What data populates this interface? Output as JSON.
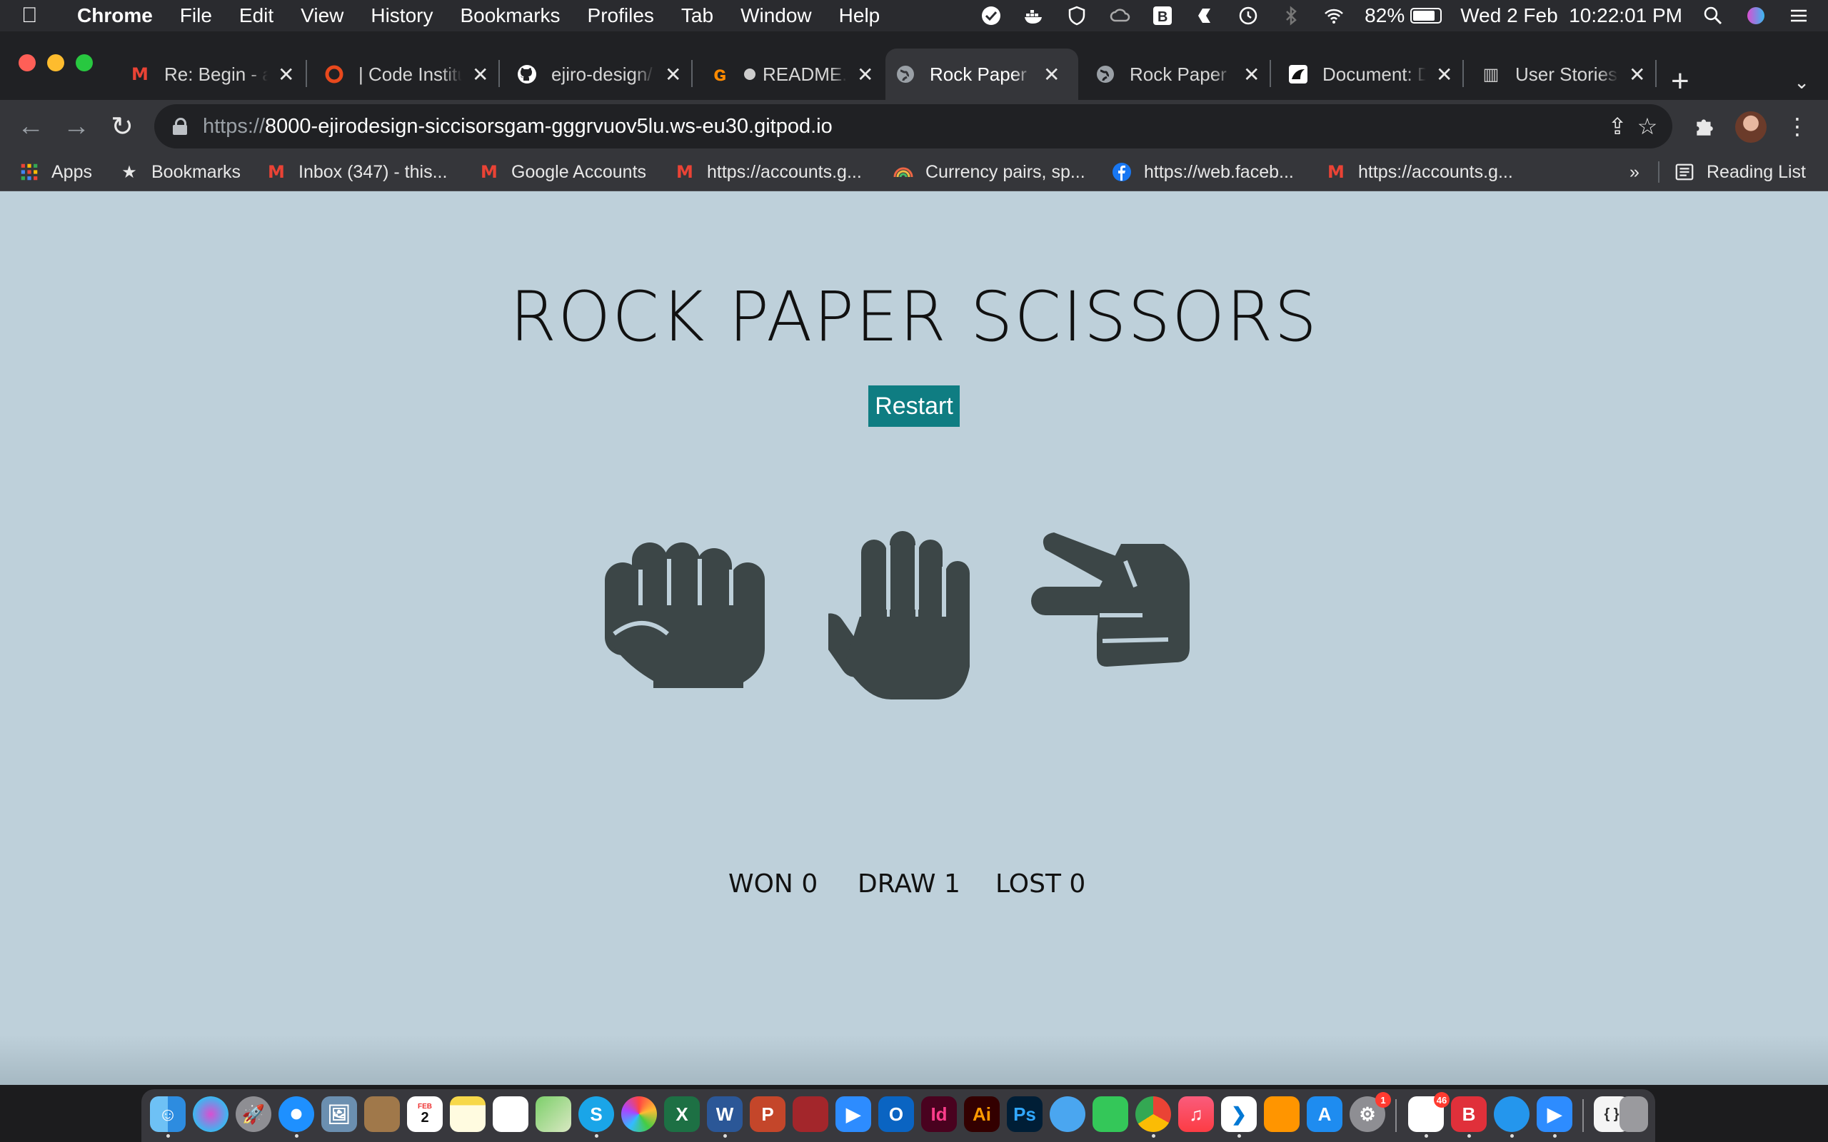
{
  "menubar": {
    "app": "Chrome",
    "menus": [
      "File",
      "Edit",
      "View",
      "History",
      "Bookmarks",
      "Profiles",
      "Tab",
      "Window",
      "Help"
    ],
    "battery_percent": "82%",
    "battery_level": 0.82,
    "datetime": "Wed 2 Feb  10:22:01 PM"
  },
  "tabs": [
    {
      "title": "Re: Begin - a",
      "icon": "gmail-icon",
      "active": false
    },
    {
      "title": "| Code Institu",
      "icon": "code-institute-icon",
      "active": false
    },
    {
      "title": "ejiro-design/",
      "icon": "github-icon",
      "active": false
    },
    {
      "title": "README.m",
      "icon": "gitpod-icon",
      "active": false
    },
    {
      "title": "Rock Paper S",
      "icon": "globe-icon",
      "active": true
    },
    {
      "title": "Rock Paper S",
      "icon": "globe-icon",
      "active": false
    },
    {
      "title": "Document: D",
      "icon": "mdn-icon",
      "active": false
    },
    {
      "title": "User Stories",
      "icon": "book-icon",
      "active": false
    }
  ],
  "toolbar": {
    "url_scheme": "https://",
    "url_host": "8000-ejirodesign-siccisorsgam-gggrvuov5lu.ws-eu30.gitpod.io"
  },
  "bookmarks": {
    "items": [
      {
        "label": "Apps",
        "icon": "apps-grid-icon"
      },
      {
        "label": "Bookmarks",
        "icon": "star-icon"
      },
      {
        "label": "Inbox (347) - this...",
        "icon": "gmail-icon"
      },
      {
        "label": "Google Accounts",
        "icon": "gmail-icon"
      },
      {
        "label": "https://accounts.g...",
        "icon": "gmail-icon"
      },
      {
        "label": "Currency pairs, sp...",
        "icon": "rainbow-icon"
      },
      {
        "label": "https://web.faceb...",
        "icon": "facebook-icon"
      },
      {
        "label": "https://accounts.g...",
        "icon": "gmail-icon"
      }
    ],
    "overflow": "»",
    "reading_list": "Reading List"
  },
  "game": {
    "title": "ROCK PAPER SCISSORS",
    "restart_label": "Restart",
    "choices": [
      "rock",
      "paper",
      "scissors"
    ],
    "score": {
      "won_label": "WON",
      "won": 0,
      "draw_label": "DRAW",
      "draw": 1,
      "lost_label": "LOST",
      "lost": 0
    }
  },
  "dock": {
    "apps": [
      "Finder",
      "Siri",
      "Launchpad",
      "Safari",
      "Preview",
      "Contacts",
      "Calendar",
      "Notes",
      "Reminders",
      "Maps",
      "Skype",
      "Photos",
      "Excel",
      "Word",
      "PowerPoint",
      "Photo Booth",
      "Zoom",
      "Outlook",
      "InDesign",
      "Illustrator",
      "Photoshop",
      "Messages",
      "FaceTime",
      "Chrome",
      "Music",
      "VS Code",
      "Books",
      "App Store",
      "System Preferences",
      "Slack",
      "Bear",
      "Docker",
      "Zoom",
      "Script",
      "Trash"
    ],
    "calendar_day": "2",
    "calendar_month": "FEB",
    "slack_badge": "46",
    "prefs_badge": "1"
  },
  "colors": {
    "page_bg": "#bed0da",
    "icon_fill": "#3c4647",
    "restart_bg": "#0f7d82",
    "chrome_dark": "#202124",
    "chrome_toolbar": "#35363a"
  }
}
